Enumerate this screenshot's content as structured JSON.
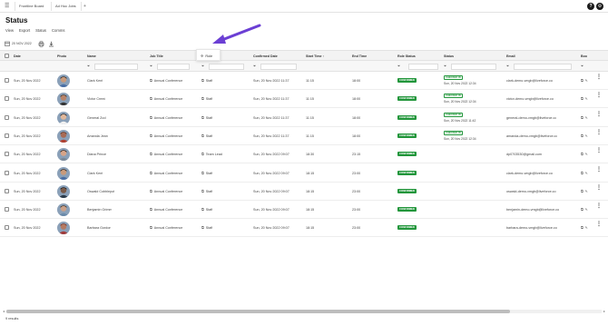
{
  "topbar": {
    "menu_icon": "hamburger-icon",
    "tabs": [
      "Frontline Board",
      "Ad Hoc Jobs"
    ],
    "plus": "+",
    "help_glyph": "?",
    "settings_icon": "gear-icon"
  },
  "page": {
    "title": "Status",
    "subnav": [
      "View",
      "Export",
      "Status",
      "Comms"
    ]
  },
  "toolbar": {
    "date": "20 NOV 2022",
    "icons": [
      "calendar-icon",
      "print-icon",
      "download-icon"
    ]
  },
  "popup": {
    "label": "Role",
    "icon": "move-icon"
  },
  "colors": {
    "confirmed": "#22963b",
    "checkedin": "#22963b",
    "arrow": "#6b3fd4"
  },
  "columns": [
    "Date",
    "Photo",
    "Name",
    "Job Title",
    "Role",
    "Confirmed Date",
    "Start Time",
    "End Time",
    "Role Status",
    "Status",
    "Email",
    "Boo"
  ],
  "sort_indicator": "↑",
  "rows": [
    {
      "date": "Sun, 20 Nov 2022",
      "name": "Clark Kent",
      "job": "Annual Conference",
      "role": "Staff",
      "confirmed": "Sun, 20 Nov 2022 11:37",
      "start": "11:15",
      "end": "18:00",
      "role_status": "CONFIRMED",
      "status": "CHECKED IN",
      "status_time": "Sun, 20 Nov 2022 12:34",
      "email": "clark-demo-vmgb@liveforce.co"
    },
    {
      "date": "Sun, 20 Nov 2022",
      "name": "Victor Creed",
      "job": "Annual Conference",
      "role": "Staff",
      "confirmed": "Sun, 20 Nov 2022 11:37",
      "start": "11:15",
      "end": "18:00",
      "role_status": "CONFIRMED",
      "status": "CHECKED IN",
      "status_time": "Sun, 20 Nov 2022 12:34",
      "email": "victor-demo-vmgb@liveforce.co"
    },
    {
      "date": "Sun, 20 Nov 2022",
      "name": "General Zod",
      "job": "Annual Conference",
      "role": "Staff",
      "confirmed": "Sun, 20 Nov 2022 11:37",
      "start": "11:15",
      "end": "18:00",
      "role_status": "CONFIRMED",
      "status": "CHECKED IN",
      "status_time": "Sun, 20 Nov 2022 11:42",
      "email": "general-demo-vmgb@liveforce.co"
    },
    {
      "date": "Sun, 20 Nov 2022",
      "name": "Amanda Jean",
      "job": "Annual Conference",
      "role": "Staff",
      "confirmed": "Sun, 20 Nov 2022 11:37",
      "start": "11:15",
      "end": "18:00",
      "role_status": "CONFIRMED",
      "status": "CHECKED IN",
      "status_time": "Sun, 20 Nov 2022 12:34",
      "email": "amanda-demo-vmgb@liveforce.co"
    },
    {
      "date": "Sun, 20 Nov 2022",
      "name": "Diana Prince",
      "job": "Annual Conference",
      "role": "Team Lead",
      "confirmed": "Sun, 20 Nov 2022 09:07",
      "start": "18:30",
      "end": "23:15",
      "role_status": "CONFIRMED",
      "status": "",
      "status_time": "",
      "email": "dp0703530@gmail.com"
    },
    {
      "date": "Sun, 20 Nov 2022",
      "name": "Clark Kent",
      "job": "Annual Conference",
      "role": "Staff",
      "confirmed": "Sun, 20 Nov 2022 09:07",
      "start": "18:15",
      "end": "23:00",
      "role_status": "CONFIRMED",
      "status": "",
      "status_time": "",
      "email": "clark-demo-vmgb@liveforce.co"
    },
    {
      "date": "Sun, 20 Nov 2022",
      "name": "Oswald Cobblepot",
      "job": "Annual Conference",
      "role": "Staff",
      "confirmed": "Sun, 20 Nov 2022 09:07",
      "start": "18:15",
      "end": "23:00",
      "role_status": "CONFIRMED",
      "status": "",
      "status_time": "",
      "email": "oswald-demo-vmgb@liveforce.co"
    },
    {
      "date": "Sun, 20 Nov 2022",
      "name": "Benjamin Grimm",
      "job": "Annual Conference",
      "role": "Staff",
      "confirmed": "Sun, 20 Nov 2022 09:07",
      "start": "18:15",
      "end": "23:00",
      "role_status": "CONFIRMED",
      "status": "",
      "status_time": "",
      "email": "benjamin-demo-vmgb@liveforce.co"
    },
    {
      "date": "Sun, 20 Nov 2022",
      "name": "Barbara Gordon",
      "job": "Annual Conference",
      "role": "Staff",
      "confirmed": "Sun, 20 Nov 2022 09:07",
      "start": "18:15",
      "end": "23:00",
      "role_status": "CONFIRMED",
      "status": "",
      "status_time": "",
      "email": "barbara-demo-vmgb@liveforce.co"
    }
  ],
  "footer": {
    "results": "9 results"
  }
}
